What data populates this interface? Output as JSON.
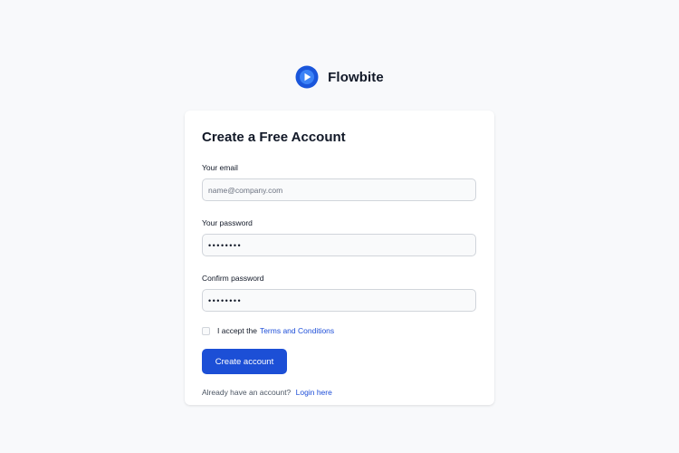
{
  "brand": {
    "name": "Flowbite",
    "logo_icon": "flowbite-logo-icon",
    "logo_colors": [
      "#1a56db",
      "#3b82f6",
      "#ffffff"
    ]
  },
  "form": {
    "title": "Create a Free Account",
    "email": {
      "label": "Your email",
      "placeholder": "name@company.com",
      "value": ""
    },
    "password": {
      "label": "Your password",
      "value": "••••••••"
    },
    "confirm_password": {
      "label": "Confirm password",
      "value": "••••••••"
    },
    "terms": {
      "checked": false,
      "text": "I accept the",
      "link_text": "Terms and Conditions"
    },
    "submit_label": "Create account",
    "login_prompt": "Already have an account?",
    "login_link_text": "Login here"
  },
  "colors": {
    "page_bg": "#f8f9fb",
    "primary": "#1c4fd6",
    "link": "#1d4ed8",
    "input_bg": "#f9fafb",
    "input_border": "#d1d5db"
  }
}
